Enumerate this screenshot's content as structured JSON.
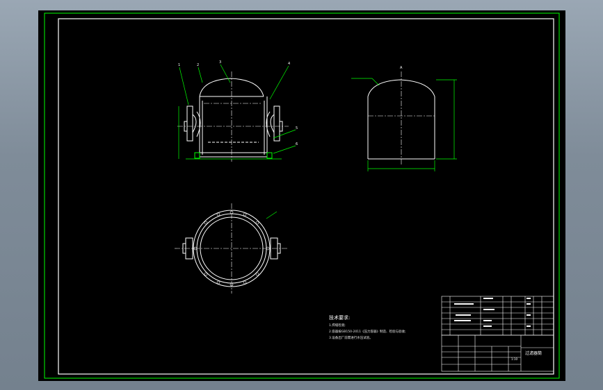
{
  "colors": {
    "background": "#000000",
    "frame": "#ffffff",
    "outline": "#ffffff",
    "dimension": "#00ff00",
    "centerline": "#ffffff"
  },
  "drawing": {
    "callouts": [
      "1",
      "2",
      "3",
      "4",
      "5",
      "6"
    ],
    "top_label_right": "A",
    "notes_title": "技术要求:",
    "notes": [
      "1.焊缝检测;",
      "2.容器按GB150-2011《压力容器》制造、检验与验收;",
      "3.设备出厂前需进行水压试验。"
    ],
    "title_block": {
      "drawing_name": "过滤器筒",
      "scale": "1:10"
    }
  }
}
